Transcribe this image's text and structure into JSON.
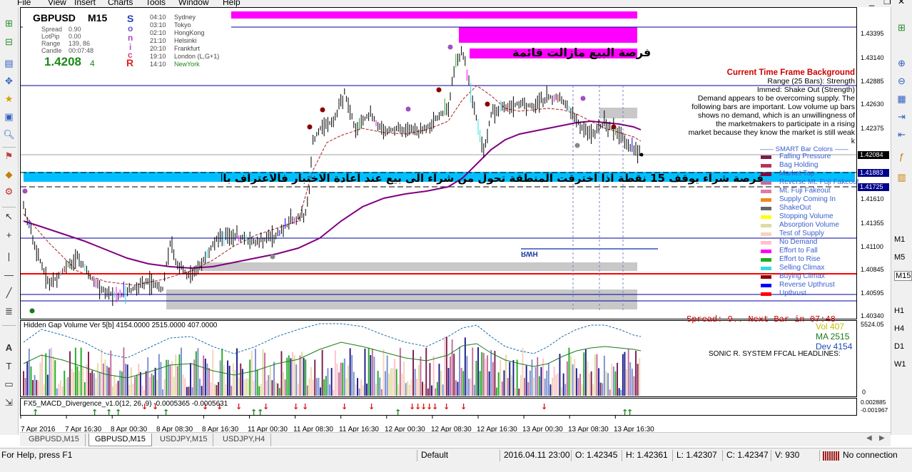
{
  "menu": [
    "File",
    "View",
    "Insert",
    "Charts",
    "Tools",
    "Window",
    "Help"
  ],
  "info_panel": {
    "symbol": "GBPUSD",
    "timeframe": "M15",
    "rows": [
      {
        "label": "Spread",
        "value": "0.90"
      },
      {
        "label": "LotPip",
        "value": "0.00"
      },
      {
        "label": "Range",
        "value": "139, 86"
      },
      {
        "label": "Candle",
        "value": "00:07:48"
      }
    ],
    "price": "1.4208",
    "price_digit": "4",
    "sonic_letters": [
      "S",
      "o",
      "n",
      "i",
      "c",
      "R"
    ],
    "sessions": [
      {
        "time": "04:10",
        "city": "Sydney"
      },
      {
        "time": "03:10",
        "city": "Tokyo"
      },
      {
        "time": "02:10",
        "city": "HongKong"
      },
      {
        "time": "21:10",
        "city": "Helsinki"
      },
      {
        "time": "20:10",
        "city": "Frankfurt"
      },
      {
        "time": "19:10",
        "city": "London  (L,G+1)"
      },
      {
        "time": "14:10",
        "city": "NewYork"
      }
    ]
  },
  "annotations": {
    "sell_text": "فرصة البيع مازالت قائمة",
    "buy_text": "فرصة شراء يوقف 15 نقطة اذا اخترقت المنطقة تحول من شراء الى بيع عند اعادة الاختبار فالاعتراف بالخطأ فضيلة"
  },
  "ctf": {
    "title": "Current Time Frame Background",
    "range": "Range (25 Bars): Strength",
    "immed": "Immed: Shake Out (Strength)",
    "desc": [
      "Demand appears to be overcoming supply. The",
      "following bars are important. Low volume up bars",
      "shows no demand, which is an unwillingness of",
      "the marketmakers to participate in a rising",
      "market because they know the market is still weak"
    ],
    "k": "k",
    "smart": "SMART Bar Colors"
  },
  "bar_legend": [
    {
      "label": "Falling Pressure",
      "color": "#7b1c4a"
    },
    {
      "label": "Bag Holding",
      "color": "#b8325a"
    },
    {
      "label": "Market Top",
      "color": "#8b0040"
    },
    {
      "label": "Reverse Mt. Fuji Fakeout",
      "color": "#c36b9c"
    },
    {
      "label": "Mt. Fuji Fakeout",
      "color": "#e07aa8"
    },
    {
      "label": "Supply Coming In",
      "color": "#f08a1a"
    },
    {
      "label": "ShakeOut",
      "color": "#666666"
    },
    {
      "label": "Stopping Volume",
      "color": "#ffff00"
    },
    {
      "label": "Absorption Volume",
      "color": "#dedca0"
    },
    {
      "label": "Test of Supply",
      "color": "#f6d3b8"
    },
    {
      "label": "No Demand",
      "color": "#ffc0cb"
    },
    {
      "label": "Effort to Fall",
      "color": "#ff00ff"
    },
    {
      "label": "Effort to Rise",
      "color": "#22aa22"
    },
    {
      "label": "Selling Climax",
      "color": "#33dddd"
    },
    {
      "label": "Buying Climax",
      "color": "#8b0000"
    },
    {
      "label": "Reverse Upthrust",
      "color": "#0000ff"
    },
    {
      "label": "Upthrust",
      "color": "#ff0000"
    }
  ],
  "price_axis": [
    "1.43395",
    "1.43140",
    "1.42885",
    "1.42630",
    "1.42375",
    "1.42084",
    "1.41883",
    "1.41725",
    "1.41610",
    "1.41355",
    "1.41100",
    "1.40845",
    "1.40595",
    "1.40340"
  ],
  "price_boxes": {
    "current": "1.42084",
    "b1": "1.41883",
    "b2": "1.41725"
  },
  "rwh": "RWH",
  "spread_text": "Spread: 9.. Next Bar in 07:48",
  "volume_indicator": {
    "label": "Hidden Gap Volume Ver 5[b] 4154.0000 2515.0000 407.0000",
    "vol": "Vol  407",
    "ma": "MA  2515",
    "dev": "Dev  4154",
    "headline": "SONIC R. SYSTEM  FFCAL HEADLINES:",
    "axis_top": "5524.05",
    "axis_bottom": "0"
  },
  "macd": {
    "label": "FX5_MACD_Divergence_v1.0(12, 26, 9) -0.0005365 -0.0005631",
    "axis_top": "0.002885",
    "axis_bottom": "-0.001967"
  },
  "time_axis": [
    "7 Apr 2016",
    "7 Apr 16:30",
    "8 Apr 00:30",
    "8 Apr 08:30",
    "8 Apr 16:30",
    "11 Apr 00:30",
    "11 Apr 08:30",
    "11 Apr 16:30",
    "12 Apr 00:30",
    "12 Apr 08:30",
    "12 Apr 16:30",
    "13 Apr 00:30",
    "13 Apr 08:30",
    "13 Apr 16:30"
  ],
  "tabs": [
    "GBPUSD,M15",
    "GBPUSD,M15",
    "USDJPY,M15",
    "USDJPY,H4"
  ],
  "active_tab": 1,
  "status": {
    "help": "For Help, press F1",
    "profile": "Default",
    "datetime": "2016.04.11 23:00",
    "open": "O: 1.42345",
    "high": "H: 1.42361",
    "low": "L: 1.42307",
    "close": "C: 1.42347",
    "volume": "V: 930",
    "connection": "No connection"
  },
  "right_strip": [
    "M1",
    "M5",
    "M15",
    "H1",
    "H4",
    "D1",
    "W1"
  ]
}
